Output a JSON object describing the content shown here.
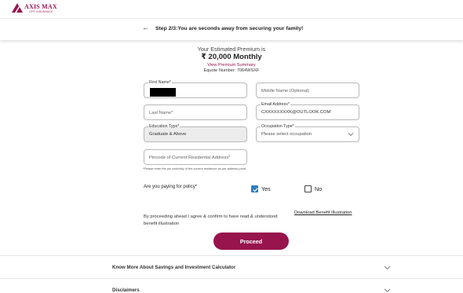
{
  "header": {
    "brand_name": "AXIS MAX",
    "brand_sub": "LIFE INSURANCE"
  },
  "step": {
    "back_icon": "arrow-left-icon",
    "text": "Step 2/3:You are seconds away from securing your family!"
  },
  "premium": {
    "label": "Your Estimated Premium is",
    "amount": "₹ 20,000 Monthly",
    "summary_link": "View Premium Summary",
    "equote": "Equote Number: 7064WSXF"
  },
  "form": {
    "first_name": {
      "label": "First Name*",
      "value": ""
    },
    "middle_name": {
      "placeholder": "Middle Name (Optional)"
    },
    "last_name": {
      "placeholder": "Last Name*"
    },
    "email": {
      "label": "Email Address*",
      "value": "CXXXXXXXXK@OUTLOOK.COM"
    },
    "education": {
      "label": "Education Type*",
      "value": "Graduate & Above"
    },
    "occupation": {
      "label": "Occupation Type*",
      "placeholder": "Please select occupation"
    },
    "pincode": {
      "placeholder": "Pincode of Current Residential Address*"
    },
    "pincode_note": "*Please enter the pin code/city of the current residence as per address proof"
  },
  "policy_question": {
    "label": "Are you paying for policy*",
    "options": [
      {
        "label": "Yes",
        "checked": true
      },
      {
        "label": "No",
        "checked": false
      }
    ]
  },
  "consent": {
    "text": "By proceeding ahead I agree & confirm to have read & understood benefit illustration",
    "download_link": "Download Benefit Illustration"
  },
  "proceed_label": "Proceed",
  "accordions": [
    {
      "title": "Know More About Savings and Investment Calculator"
    },
    {
      "title": "Disclaimers"
    }
  ],
  "colors": {
    "brand": "#97144d",
    "checkbox_checked": "#2f7dc0"
  }
}
